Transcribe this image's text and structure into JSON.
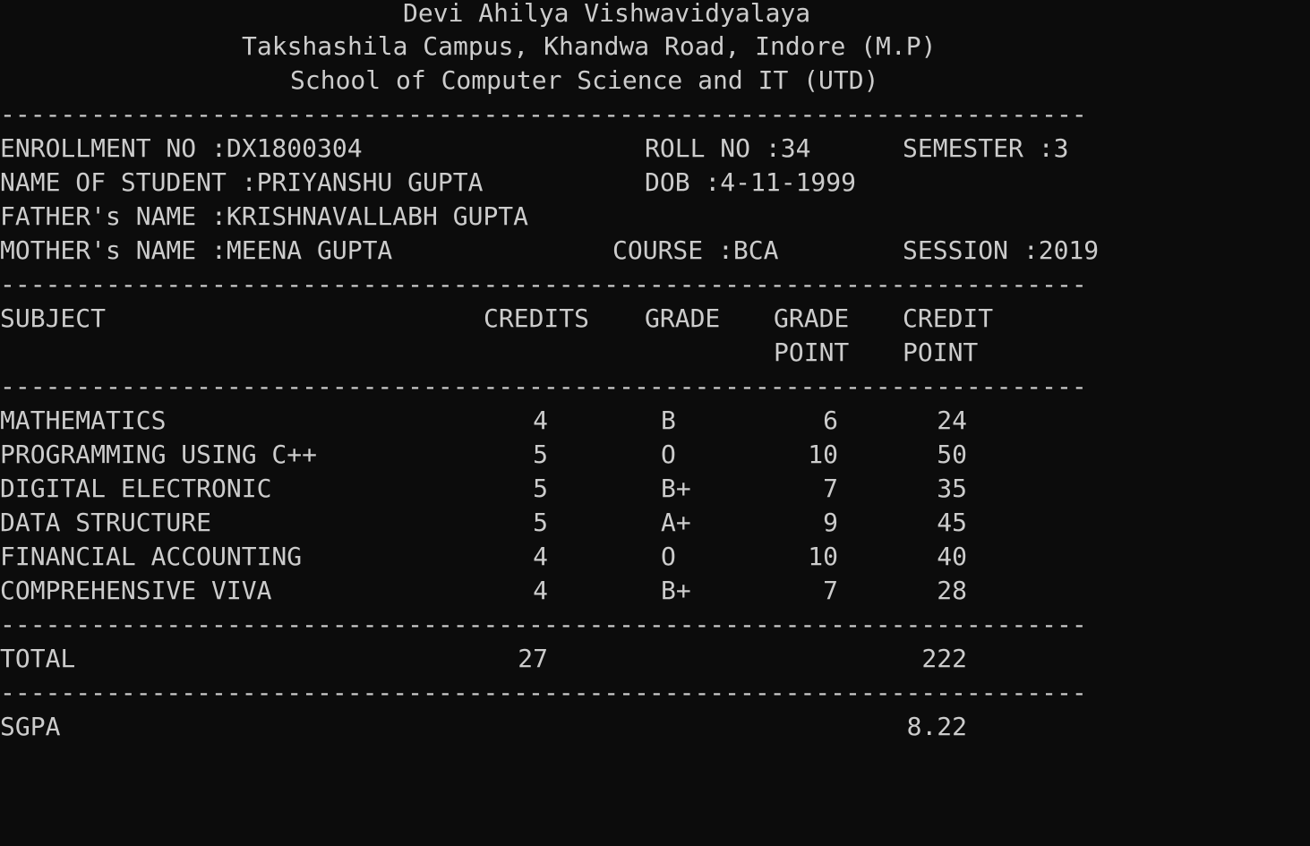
{
  "header": {
    "university": "Devi Ahilya Vishwavidyalaya",
    "campus": "Takshashila Campus, Khandwa Road, Indore (M.P)",
    "school": "School of Computer Science and IT (UTD)"
  },
  "divider": "------------------------------------------------------------------------",
  "student": {
    "enrollment": "ENROLLMENT NO :DX1800304",
    "roll": "ROLL NO :34",
    "semester": "SEMESTER :3",
    "name": "NAME OF STUDENT :PRIYANSHU GUPTA",
    "dob": "DOB :4-11-1999",
    "father": "FATHER's NAME :KRISHNAVALLABH GUPTA",
    "mother": "MOTHER's NAME :MEENA GUPTA",
    "course": "COURSE :BCA",
    "session": "SESSION :2019"
  },
  "table": {
    "headers": {
      "subject": "SUBJECT",
      "credits": "CREDITS",
      "grade": "GRADE",
      "grade_point_1": "GRADE",
      "grade_point_2": "POINT",
      "credit_point_1": "CREDIT",
      "credit_point_2": "POINT"
    },
    "rows": [
      {
        "subject": "MATHEMATICS",
        "credits": "4",
        "grade": "B",
        "grade_point": "6",
        "credit_point": "24"
      },
      {
        "subject": "PROGRAMMING USING C++",
        "credits": "5",
        "grade": "O",
        "grade_point": "10",
        "credit_point": "50"
      },
      {
        "subject": "DIGITAL ELECTRONIC",
        "credits": "5",
        "grade": "B+",
        "grade_point": "7",
        "credit_point": "35"
      },
      {
        "subject": "DATA STRUCTURE",
        "credits": "5",
        "grade": "A+",
        "grade_point": "9",
        "credit_point": "45"
      },
      {
        "subject": "FINANCIAL ACCOUNTING",
        "credits": "4",
        "grade": "O",
        "grade_point": "10",
        "credit_point": "40"
      },
      {
        "subject": "COMPREHENSIVE VIVA",
        "credits": "4",
        "grade": "B+",
        "grade_point": "7",
        "credit_point": "28"
      }
    ]
  },
  "totals": {
    "label": "TOTAL",
    "credits": "27",
    "credit_points": "222"
  },
  "sgpa": {
    "label": "SGPA",
    "value": "8.22"
  },
  "colors": {
    "background": "#0c0c0c",
    "text": "#cccccc"
  }
}
